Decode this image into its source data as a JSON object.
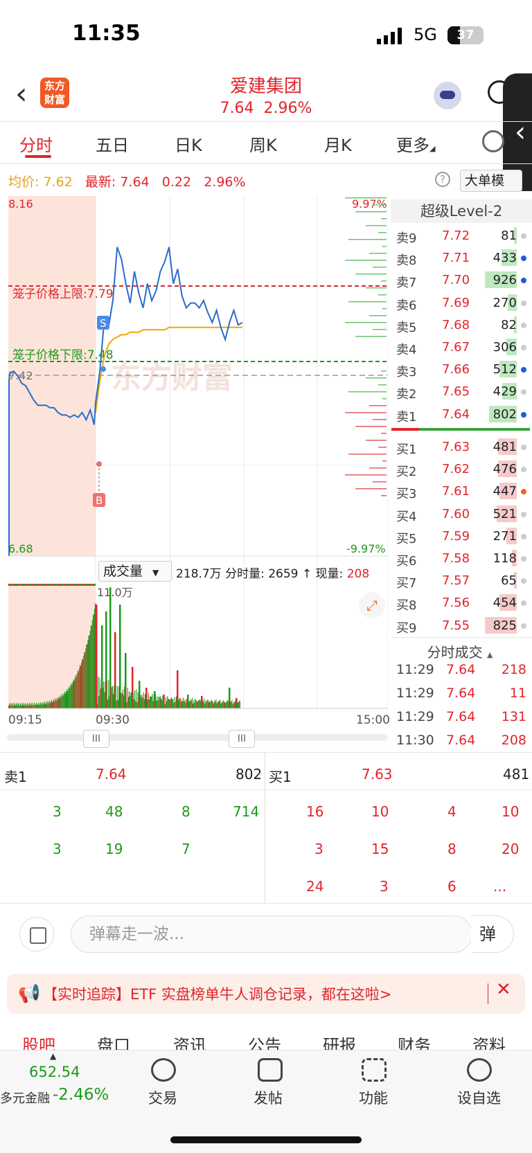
{
  "status": {
    "time": "11:35",
    "network": "5G",
    "battery": "37"
  },
  "header": {
    "back": "‹",
    "logo": "东方\n财富",
    "title": "爱建集团",
    "price": "7.64",
    "change_pct": "2.96%"
  },
  "periods": [
    {
      "label": "分时"
    },
    {
      "label": "五日"
    },
    {
      "label": "日K"
    },
    {
      "label": "周K"
    },
    {
      "label": "月K"
    },
    {
      "label": "更多"
    }
  ],
  "info": {
    "avg_label": "均价:",
    "avg": "7.62",
    "last_label": "最新:",
    "last": "7.64",
    "chg": "0.22",
    "chg_pct": "2.96%",
    "help": "?",
    "big_order": "大单模"
  },
  "chart": {
    "y_high": "8.16",
    "y_low": "6.68",
    "pct_high": "9.97%",
    "pct_low": "-9.97%",
    "prev_close": "7.42",
    "cage_upper_label": "笼子价格上限:",
    "cage_upper": "7.79",
    "cage_lower_label": "笼子价格下限:",
    "cage_lower": "7.48",
    "watermark": "东方财富",
    "marker_s": "S",
    "marker_b": "B"
  },
  "chart_data": {
    "type": "line",
    "title": "",
    "ylim": [
      6.68,
      8.16
    ],
    "prev_close": 7.42,
    "price_series": [
      7.4,
      7.43,
      7.44,
      7.42,
      7.39,
      7.38,
      7.35,
      7.32,
      7.3,
      7.3,
      7.3,
      7.29,
      7.29,
      7.27,
      7.26,
      7.26,
      7.25,
      7.26,
      7.25,
      7.27,
      7.24,
      7.28,
      7.22,
      7.31,
      7.44,
      7.65,
      7.62,
      7.73,
      7.95,
      7.9,
      7.8,
      7.72,
      7.85,
      7.76,
      7.7,
      7.8,
      7.73,
      7.77,
      7.85,
      7.89,
      7.95,
      7.8,
      7.86,
      7.75,
      7.7,
      7.72,
      7.72,
      7.7,
      7.73,
      7.68,
      7.64,
      7.69,
      7.62,
      7.57,
      7.64,
      7.69,
      7.63,
      7.64
    ],
    "avg_series": [
      null,
      null,
      null,
      null,
      null,
      null,
      null,
      null,
      null,
      null,
      null,
      null,
      null,
      null,
      null,
      null,
      null,
      null,
      null,
      null,
      null,
      null,
      null,
      7.27,
      7.4,
      7.5,
      7.55,
      7.57,
      7.58,
      7.59,
      7.59,
      7.6,
      7.6,
      7.6,
      7.61,
      7.61,
      7.61,
      7.61,
      7.61,
      7.61,
      7.62,
      7.62,
      7.62,
      7.62,
      7.62,
      7.62,
      7.62,
      7.62,
      7.62,
      7.62,
      7.62,
      7.62,
      7.62,
      7.62,
      7.62,
      7.62,
      7.62,
      7.62
    ],
    "volume_label": "11.0万",
    "x_ticks": [
      "09:15",
      "09:30",
      "15:00"
    ]
  },
  "volume": {
    "selector": "成交量",
    "total": "218.7万",
    "minute_vol_label": "分时量:",
    "minute_vol": "2659",
    "arrow": "↑",
    "cur_label": "现量:",
    "cur": "208",
    "expand": "⤢"
  },
  "xaxis": {
    "t1": "09:15",
    "t2": "09:30",
    "t3": "15:00",
    "handle": "III"
  },
  "orderbook": {
    "title": "超级Level-2",
    "asks": [
      {
        "label": "卖9",
        "price": "7.72",
        "vol": "81",
        "dot": "#ccc"
      },
      {
        "label": "卖8",
        "price": "7.71",
        "vol": "433",
        "dot": "#1a5fd6"
      },
      {
        "label": "卖7",
        "price": "7.70",
        "vol": "926",
        "dot": "#1a5fd6"
      },
      {
        "label": "卖6",
        "price": "7.69",
        "vol": "270",
        "dot": "#ccc"
      },
      {
        "label": "卖5",
        "price": "7.68",
        "vol": "82",
        "dot": "#ccc"
      },
      {
        "label": "卖4",
        "price": "7.67",
        "vol": "306",
        "dot": "#ccc"
      },
      {
        "label": "卖3",
        "price": "7.66",
        "vol": "512",
        "dot": "#1a5fd6"
      },
      {
        "label": "卖2",
        "price": "7.65",
        "vol": "429",
        "dot": "#ccc"
      },
      {
        "label": "卖1",
        "price": "7.64",
        "vol": "802",
        "dot": "#1a5fd6"
      }
    ],
    "bids": [
      {
        "label": "买1",
        "price": "7.63",
        "vol": "481",
        "dot": "#ccc"
      },
      {
        "label": "买2",
        "price": "7.62",
        "vol": "476",
        "dot": "#ccc"
      },
      {
        "label": "买3",
        "price": "7.61",
        "vol": "447",
        "dot": "#f26522"
      },
      {
        "label": "买4",
        "price": "7.60",
        "vol": "521",
        "dot": "#ccc"
      },
      {
        "label": "买5",
        "price": "7.59",
        "vol": "271",
        "dot": "#ccc"
      },
      {
        "label": "买6",
        "price": "7.58",
        "vol": "118",
        "dot": "#ccc"
      },
      {
        "label": "买7",
        "price": "7.57",
        "vol": "65",
        "dot": "#ccc"
      },
      {
        "label": "买8",
        "price": "7.56",
        "vol": "454",
        "dot": "#ccc"
      },
      {
        "label": "买9",
        "price": "7.55",
        "vol": "825",
        "dot": "#ccc"
      }
    ]
  },
  "ticks": {
    "title": "分时成交",
    "arrow": "▲",
    "rows": [
      {
        "time": "11:29",
        "price": "7.64",
        "vol": "218"
      },
      {
        "time": "11:29",
        "price": "7.64",
        "vol": "11"
      },
      {
        "time": "11:29",
        "price": "7.64",
        "vol": "131"
      },
      {
        "time": "11:30",
        "price": "7.64",
        "vol": "208"
      }
    ]
  },
  "queue": {
    "sell_label": "卖1",
    "sell_price": "7.64",
    "sell_vol": "802",
    "buy_label": "买1",
    "buy_price": "7.63",
    "buy_vol": "481",
    "sell_rows": [
      [
        "3",
        "48",
        "8",
        "714"
      ],
      [
        "3",
        "19",
        "7",
        ""
      ]
    ],
    "buy_rows": [
      [
        "16",
        "10",
        "4",
        "10"
      ],
      [
        "3",
        "15",
        "8",
        "20"
      ],
      [
        "24",
        "3",
        "6",
        "..."
      ]
    ]
  },
  "danmu": {
    "placeholder": "弹幕走一波...",
    "button": "弹"
  },
  "banner": {
    "icon": "📢",
    "text": "【实时追踪】ETF 实盘榜单牛人调仓记录，都在这啦>",
    "close": "✕"
  },
  "info_tabs": [
    {
      "label": "股吧"
    },
    {
      "label": "盘口"
    },
    {
      "label": "资讯"
    },
    {
      "label": "公告"
    },
    {
      "label": "研报"
    },
    {
      "label": "财务"
    },
    {
      "label": "资料"
    }
  ],
  "bottom": {
    "index_value": "652.54",
    "index_name": "多元金融",
    "index_change": "-2.46%",
    "arrow": "▲",
    "buttons": [
      {
        "label": "交易"
      },
      {
        "label": "发帖"
      },
      {
        "label": "功能"
      },
      {
        "label": "设自选"
      }
    ]
  }
}
